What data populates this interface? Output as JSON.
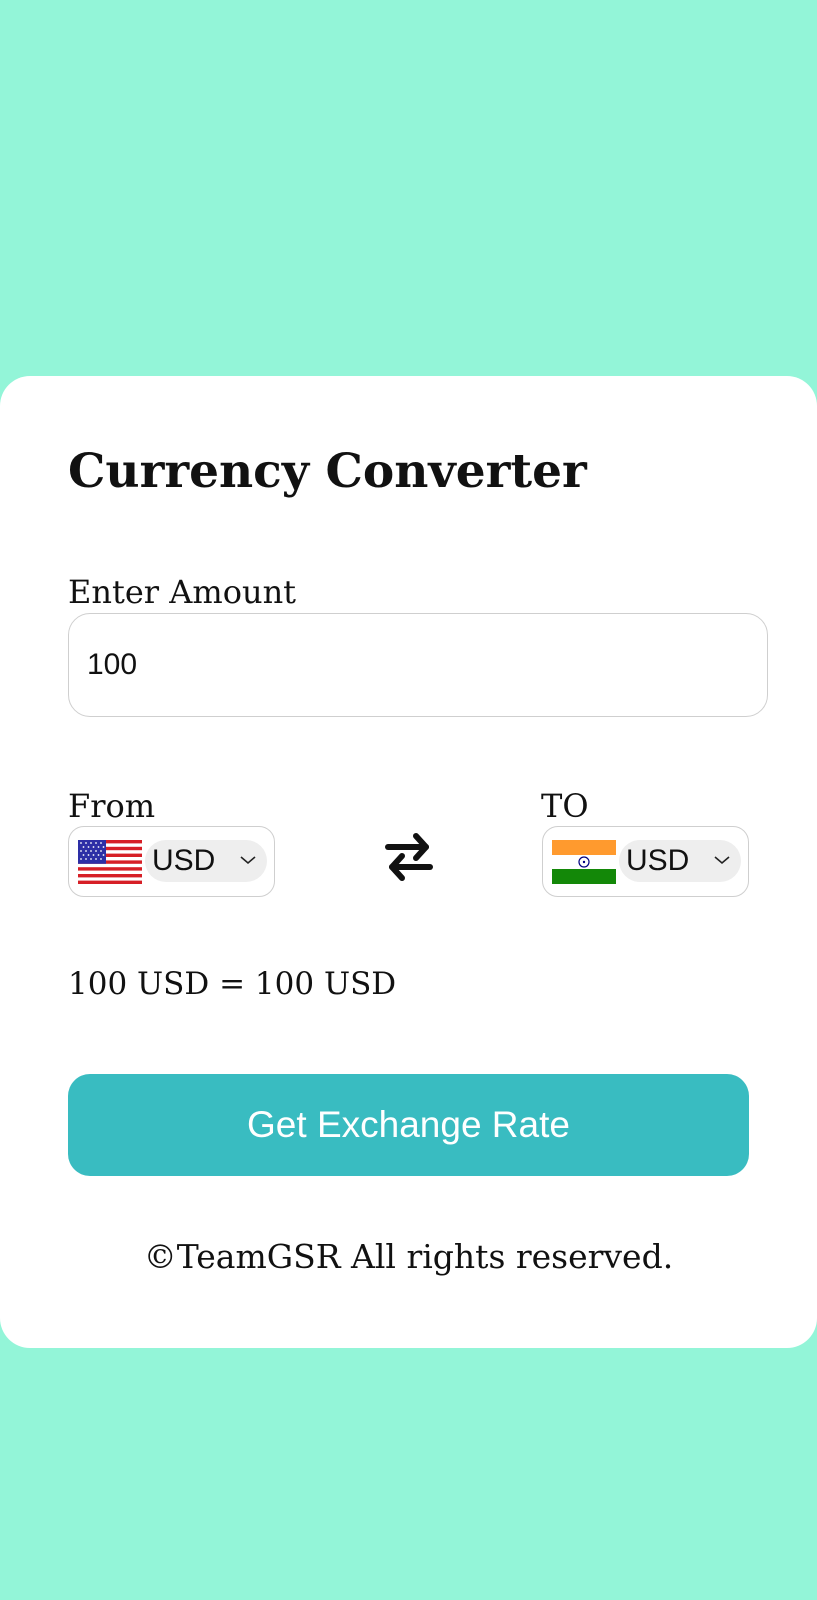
{
  "app": {
    "title": "Currency Converter"
  },
  "amount": {
    "label": "Enter Amount",
    "value": "100"
  },
  "from": {
    "label": "From",
    "currency": "USD",
    "flag": "united-states-flag"
  },
  "to": {
    "label": "TO",
    "currency": "USD",
    "flag": "india-flag"
  },
  "swap_icon": "swap-arrows-icon",
  "result": {
    "text": "100 USD = 100 USD"
  },
  "button": {
    "label": "Get Exchange Rate"
  },
  "footer": {
    "text": "©TeamGSR All rights reserved."
  },
  "colors": {
    "background": "#93f5d8",
    "card": "#ffffff",
    "button": "#39bcc1",
    "button_text": "#ffffff",
    "text": "#111111"
  }
}
